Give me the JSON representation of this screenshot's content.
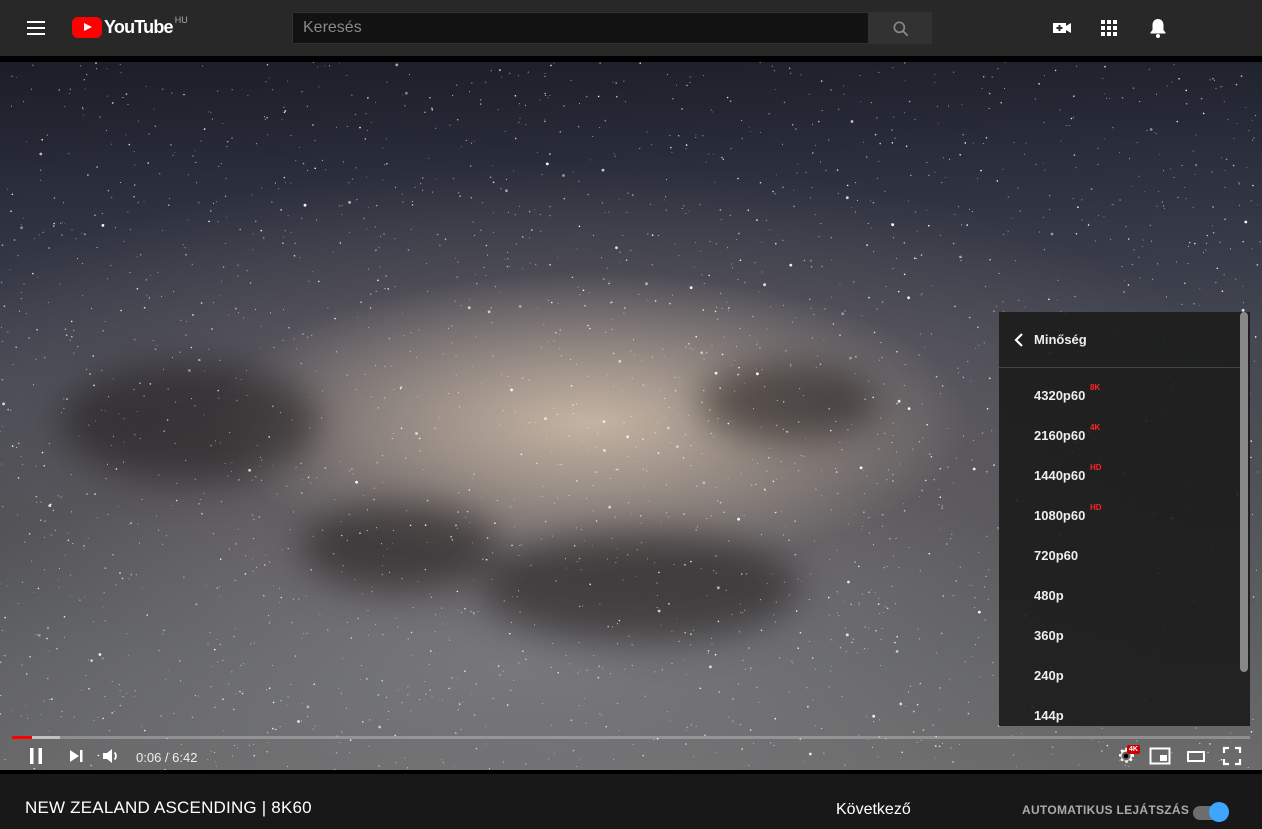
{
  "masthead": {
    "logo_text": "YouTube",
    "country_code": "HU",
    "search_placeholder": "Keresés"
  },
  "player": {
    "current_time": "0:06",
    "duration": "6:42",
    "time_separator": " / ",
    "progress_played_percent": 1.6,
    "progress_buffered_percent": 3.9,
    "settings_badge": "4K",
    "quality_menu": {
      "title": "Minőség",
      "options": [
        {
          "label": "4320p60",
          "badge": "8K"
        },
        {
          "label": "2160p60",
          "badge": "4K"
        },
        {
          "label": "1440p60",
          "badge": "HD"
        },
        {
          "label": "1080p60",
          "badge": "HD"
        },
        {
          "label": "720p60",
          "badge": ""
        },
        {
          "label": "480p",
          "badge": ""
        },
        {
          "label": "360p",
          "badge": ""
        },
        {
          "label": "240p",
          "badge": ""
        },
        {
          "label": "144p",
          "badge": ""
        }
      ]
    }
  },
  "video": {
    "title": "NEW ZEALAND ASCENDING | 8K60"
  },
  "sidebar": {
    "up_next_label": "Következő",
    "autoplay_label": "AUTOMATIKUS LEJÁTSZÁS",
    "autoplay_on": true
  },
  "colors": {
    "brand_red": "#ff0000",
    "toggle_blue": "#3ea6ff",
    "masthead_bg": "#282828",
    "page_bg": "#181818"
  }
}
